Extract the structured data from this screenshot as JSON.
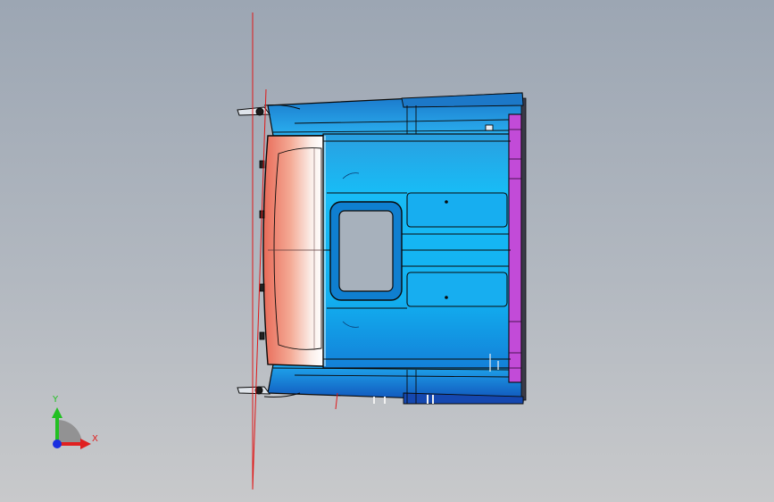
{
  "viewport": {
    "background_top": "#9ca6b3",
    "background_bottom": "#c8c9cb"
  },
  "model": {
    "roof_color": "#14b4f2",
    "front_panel_color": "#f2907a",
    "rear_trim_color": "#c24bd8",
    "outline_color": "#0a0a0a",
    "section_line_color": "#e01818"
  },
  "triad": {
    "x_label": "X",
    "y_label": "Y",
    "x_color": "#e02020",
    "y_color": "#22c022",
    "z_color": "#1a2fe0"
  }
}
